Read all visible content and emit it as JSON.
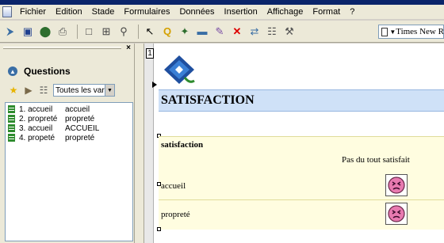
{
  "menu": [
    "Fichier",
    "Edition",
    "Stade",
    "Formulaires",
    "Données",
    "Insertion",
    "Affichage",
    "Format",
    "?"
  ],
  "toolbar": {
    "font_name": "Times New Roman",
    "icons": [
      "new-icon",
      "save-icon",
      "preview-icon",
      "print-icon",
      "find-icon",
      "layout-icon",
      "zoom-icon",
      "pointer-icon",
      "question-icon",
      "pin-icon",
      "image-icon",
      "paint-icon",
      "delete-icon",
      "link-icon",
      "edit-icon",
      "tools-icon"
    ]
  },
  "panel": {
    "title": "Questions",
    "filter_value": "Toutes les var",
    "items": [
      {
        "num": "1. accueil",
        "label": "accueil"
      },
      {
        "num": "2. propreté",
        "label": "propreté"
      },
      {
        "num": "3. accueil",
        "label": "ACCUEIL"
      },
      {
        "num": "4. propeté",
        "label": "propreté"
      }
    ]
  },
  "document": {
    "page_number": "1",
    "section_title": "SATISFACTION",
    "question_title": "satisfaction",
    "scale_label": "Pas du tout satisfait",
    "rows": [
      {
        "label": "accueil"
      },
      {
        "label": "propreté"
      }
    ]
  },
  "colors": {
    "header_bg": "#cfe1f7",
    "body_bg": "#fffde0",
    "face": "#e87ab0"
  }
}
